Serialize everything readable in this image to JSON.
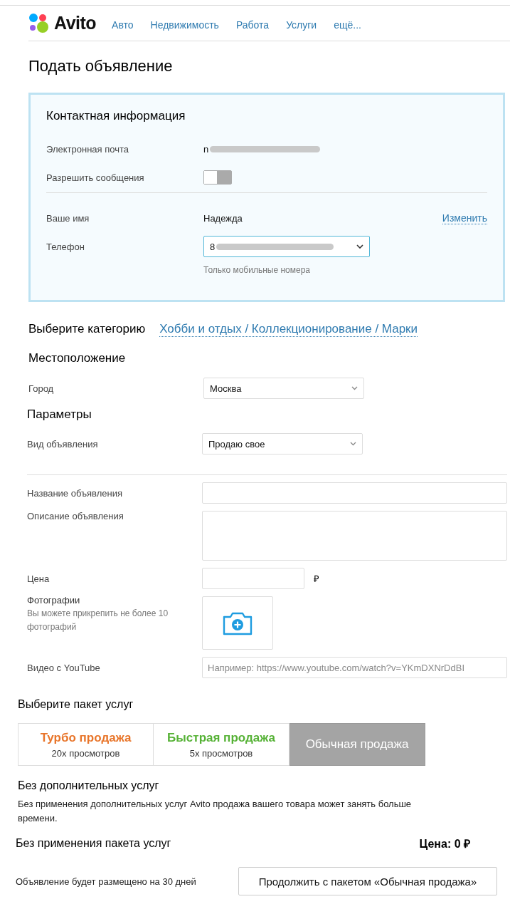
{
  "header": {
    "logo": "Avito",
    "nav": [
      "Авто",
      "Недвижимость",
      "Работа",
      "Услуги",
      "ещё..."
    ]
  },
  "page_title": "Подать объявление",
  "contact": {
    "title": "Контактная информация",
    "email": {
      "label": "Электронная почта",
      "value": "n"
    },
    "messages": {
      "label": "Разрешить сообщения",
      "on": false
    },
    "name": {
      "label": "Ваше имя",
      "value": "Надежда",
      "action": "Изменить"
    },
    "phone": {
      "label": "Телефон",
      "value": "8",
      "hint": "Только мобильные номера"
    }
  },
  "category": {
    "label": "Выберите категорию",
    "value": "Хобби и отдых / Коллекционирование / Марки"
  },
  "location": {
    "title": "Местоположение",
    "city": {
      "label": "Город",
      "value": "Москва"
    }
  },
  "params": {
    "title": "Параметры",
    "type": {
      "label": "Вид объявления",
      "value": "Продаю свое"
    }
  },
  "fields": [
    {
      "kind": "input",
      "label": "Название объявления"
    },
    {
      "kind": "textarea",
      "label": "Описание объявления"
    },
    {
      "kind": "price",
      "label": "Цена",
      "unit": "₽"
    },
    {
      "kind": "photos",
      "label": "Фотографии",
      "hint": "Вы можете прикрепить не более 10 фотографий"
    },
    {
      "kind": "input",
      "label": "Видео с YouTube",
      "placeholder": "Например: https://www.youtube.com/watch?v=YKmDXNrDdBI"
    }
  ],
  "packages": {
    "title": "Выберите пакет услуг",
    "items": [
      {
        "name": "Турбо продажа",
        "views": "20x просмотров",
        "color": "#e8752a",
        "selected": false
      },
      {
        "name": "Быстрая продажа",
        "views": "5x просмотров",
        "color": "#56b236",
        "selected": false
      },
      {
        "name": "Обычная продажа",
        "color": "#ffffff",
        "selected": true
      }
    ]
  },
  "summary": {
    "title": "Без дополнительных услуг",
    "text": "Без применения дополнительных услуг Avito продажа вашего товара может занять больше времени.",
    "package_label": "Без применения пакета услуг",
    "price": "Цена: 0 ₽",
    "duration": "Объявление будет размещено на 30 дней",
    "continue": "Продолжить с пакетом «Обычная продажа»"
  }
}
